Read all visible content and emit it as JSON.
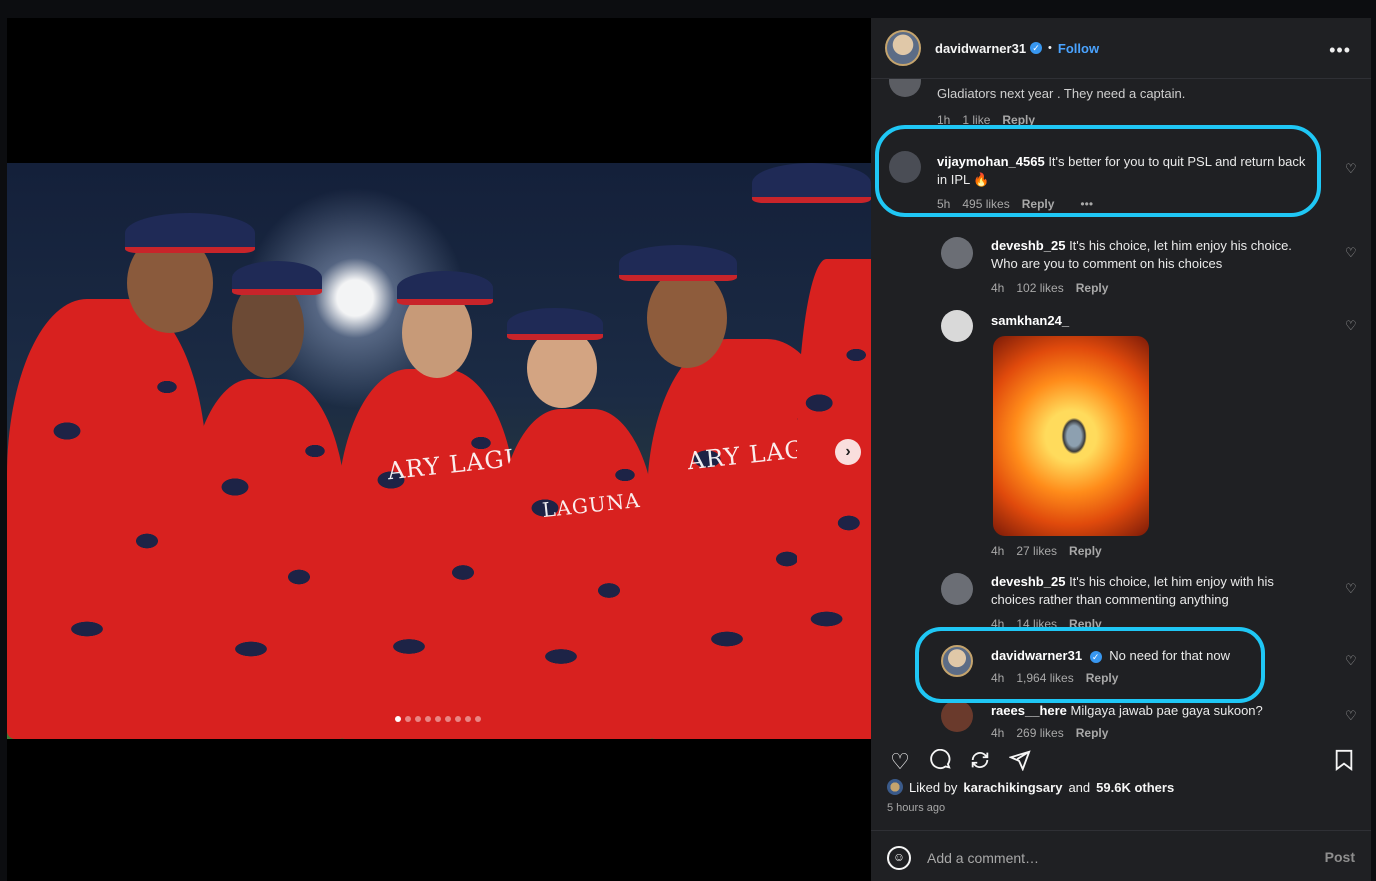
{
  "header": {
    "username": "davidwarner31",
    "separator": "•",
    "follow_label": "Follow",
    "more": "•••"
  },
  "media": {
    "jersey_text_1": "ARY LAGUNA",
    "jersey_text_2": "LAGUNA",
    "carousel_count": 9,
    "carousel_active": 0
  },
  "comments": [
    {
      "user": "",
      "text": "Gladiators next year . They need a captain.",
      "time": "1h",
      "likes": "1 like",
      "reply": "Reply"
    },
    {
      "user": "vijaymohan_4565",
      "text": "It's better for you to quit PSL and return back in IPL 🔥",
      "time": "5h",
      "likes": "495 likes",
      "reply": "Reply",
      "more": "•••"
    },
    {
      "user": "deveshb_25",
      "text": "It's his choice, let him enjoy his choice. Who are you to comment on his choices",
      "time": "4h",
      "likes": "102 likes",
      "reply": "Reply"
    },
    {
      "user": "samkhan24_",
      "text": "",
      "time": "4h",
      "likes": "27 likes",
      "reply": "Reply"
    },
    {
      "user": "deveshb_25",
      "text": "It's his choice, let him enjoy with his choices rather than commenting anything",
      "time": "4h",
      "likes": "14 likes",
      "reply": "Reply"
    },
    {
      "user": "davidwarner31",
      "text": "No need for that now",
      "time": "4h",
      "likes": "1,964 likes",
      "reply": "Reply"
    },
    {
      "user": "raees__here",
      "text": "Milgaya jawab pae gaya sukoon?",
      "time": "4h",
      "likes": "269 likes",
      "reply": "Reply"
    }
  ],
  "footer": {
    "liked_by_prefix": "Liked by",
    "liked_by_user": "karachikingsary",
    "liked_by_and": "and",
    "liked_by_others": "59.6K others",
    "time_ago": "5 hours ago",
    "add_comment_placeholder": "Add a comment…",
    "post_label": "Post"
  },
  "colors": {
    "highlight": "#1fc7f5",
    "follow": "#4aa3ff",
    "verified": "#3897f0"
  }
}
